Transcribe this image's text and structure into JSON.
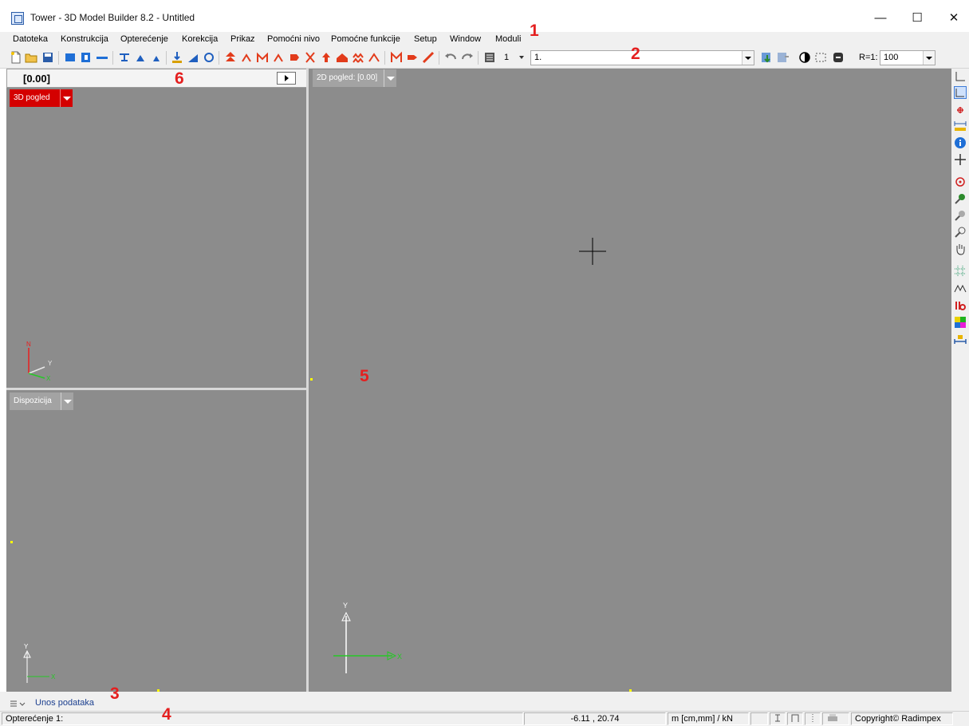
{
  "window": {
    "title": "Tower - 3D Model Builder 8.2 - Untitled",
    "controls": [
      "—",
      "☐",
      "✕"
    ]
  },
  "menu": [
    "Datoteka",
    "Konstrukcija",
    "Opterećenje",
    "Korekcija",
    "Prikaz",
    "Pomoćni nivo",
    "Pomoćne funkcije",
    "Setup",
    "Window",
    "Moduli"
  ],
  "toolbar": {
    "load_case_number": "1",
    "load_case_name": "1.",
    "scale_label": "R=1:",
    "scale_value": "100"
  },
  "left_panel": {
    "floor_level": "[0.00]",
    "view_3d_label": "3D pogled",
    "view_layout_label": "Dispozicija",
    "axis_3d": {
      "z": "N",
      "y": "Y",
      "x": "X"
    },
    "axis_2d": {
      "y": "Y",
      "x": "X"
    }
  },
  "main_view": {
    "view_label": "2D pogled: [0.00]",
    "axis": {
      "y": "Y",
      "x": "X"
    }
  },
  "annotations": [
    "1",
    "2",
    "3",
    "4",
    "5",
    "6"
  ],
  "bottom_tab": {
    "label": "Unos podataka"
  },
  "status_bar": {
    "load_case": "Opterećenje 1:",
    "coordinates": "-6.11 , 20.74",
    "units": "m [cm,mm] / kN",
    "copyright": "Copyright© Radimpex"
  },
  "colors": {
    "view_3d_button": "#d40000",
    "viewport_bg": "#8c8c8c",
    "annotation": "#e41f1f"
  }
}
